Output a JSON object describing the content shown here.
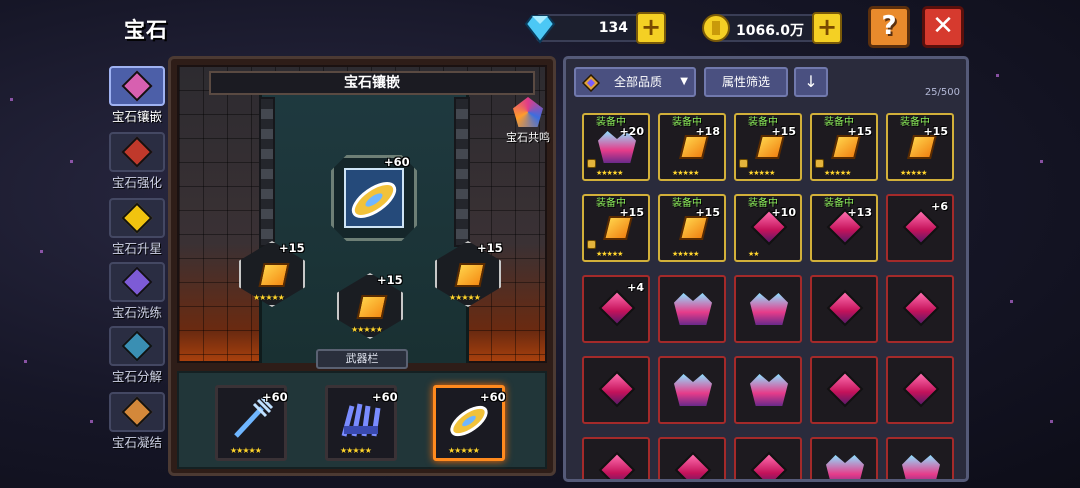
{
  "header": {
    "title": "宝石",
    "diamonds": "134",
    "gold": "1066.0万",
    "plus": "+",
    "help": "?",
    "close": "✕"
  },
  "sidebar": {
    "items": [
      {
        "label": "宝石镶嵌",
        "active": true,
        "color": "#d760b0"
      },
      {
        "label": "宝石强化",
        "active": false,
        "color": "#c0392b"
      },
      {
        "label": "宝石升星",
        "active": false,
        "color": "#f1c40f"
      },
      {
        "label": "宝石洗练",
        "active": false,
        "color": "#7d5bd6"
      },
      {
        "label": "宝石分解",
        "active": false,
        "color": "#3a8fb3"
      },
      {
        "label": "宝石凝结",
        "active": false,
        "color": "#d4883a"
      }
    ]
  },
  "inlay": {
    "title": "宝石镶嵌",
    "resonance": "宝石共鸣",
    "main_level": "+60",
    "side_slots": [
      {
        "level": "+15",
        "stars": "★★★★★"
      },
      {
        "level": "+15",
        "stars": "★★★★★"
      },
      {
        "level": "+15",
        "stars": "★★★★★"
      }
    ],
    "weapon_bar_label": "武器栏",
    "weapons": [
      {
        "level": "+60",
        "stars": "★★★★★",
        "icon": "trident-icon"
      },
      {
        "level": "+60",
        "stars": "★★★★★",
        "icon": "claw-icon"
      },
      {
        "level": "+60",
        "stars": "★★★★★",
        "icon": "disc-icon",
        "selected": true
      }
    ]
  },
  "inventory": {
    "quality_filter": "全部品质",
    "attr_filter": "属性筛选",
    "sort_icon": "↓",
    "count": "25/500",
    "equipped_tag": "装备中",
    "items": [
      {
        "level": "+20",
        "equipped": true,
        "locked": true,
        "type": "crown",
        "stars": "★★★★★"
      },
      {
        "level": "+18",
        "equipped": true,
        "locked": false,
        "type": "scroll",
        "stars": "★★★★★"
      },
      {
        "level": "+15",
        "equipped": true,
        "locked": true,
        "type": "scroll",
        "stars": "★★★★★"
      },
      {
        "level": "+15",
        "equipped": true,
        "locked": true,
        "type": "scroll",
        "stars": "★★★★★"
      },
      {
        "level": "+15",
        "equipped": true,
        "locked": false,
        "type": "scroll",
        "stars": "★★★★★"
      },
      {
        "level": "+15",
        "equipped": true,
        "locked": true,
        "type": "scroll",
        "stars": "★★★★★"
      },
      {
        "level": "+15",
        "equipped": true,
        "locked": false,
        "type": "scroll",
        "stars": "★★★★★"
      },
      {
        "level": "+10",
        "equipped": true,
        "locked": false,
        "type": "gem",
        "stars": "★★"
      },
      {
        "level": "+13",
        "equipped": true,
        "locked": false,
        "type": "gem",
        "stars": ""
      },
      {
        "level": "+6",
        "equipped": false,
        "locked": false,
        "type": "gem",
        "stars": ""
      },
      {
        "level": "+4",
        "equipped": false,
        "locked": false,
        "type": "gem",
        "stars": ""
      },
      {
        "level": "",
        "equipped": false,
        "locked": false,
        "type": "crown",
        "stars": ""
      },
      {
        "level": "",
        "equipped": false,
        "locked": false,
        "type": "crown",
        "stars": ""
      },
      {
        "level": "",
        "equipped": false,
        "locked": false,
        "type": "gem",
        "stars": ""
      },
      {
        "level": "",
        "equipped": false,
        "locked": false,
        "type": "gem",
        "stars": ""
      },
      {
        "level": "",
        "equipped": false,
        "locked": false,
        "type": "gem",
        "stars": ""
      },
      {
        "level": "",
        "equipped": false,
        "locked": false,
        "type": "crown",
        "stars": ""
      },
      {
        "level": "",
        "equipped": false,
        "locked": false,
        "type": "crown",
        "stars": ""
      },
      {
        "level": "",
        "equipped": false,
        "locked": false,
        "type": "gem",
        "stars": ""
      },
      {
        "level": "",
        "equipped": false,
        "locked": false,
        "type": "gem",
        "stars": ""
      },
      {
        "level": "",
        "equipped": false,
        "locked": false,
        "type": "gem",
        "stars": ""
      },
      {
        "level": "",
        "equipped": false,
        "locked": false,
        "type": "gem",
        "stars": ""
      },
      {
        "level": "",
        "equipped": false,
        "locked": false,
        "type": "gem",
        "stars": ""
      },
      {
        "level": "",
        "equipped": false,
        "locked": false,
        "type": "crown",
        "stars": ""
      },
      {
        "level": "",
        "equipped": false,
        "locked": false,
        "type": "crown",
        "stars": ""
      }
    ]
  }
}
